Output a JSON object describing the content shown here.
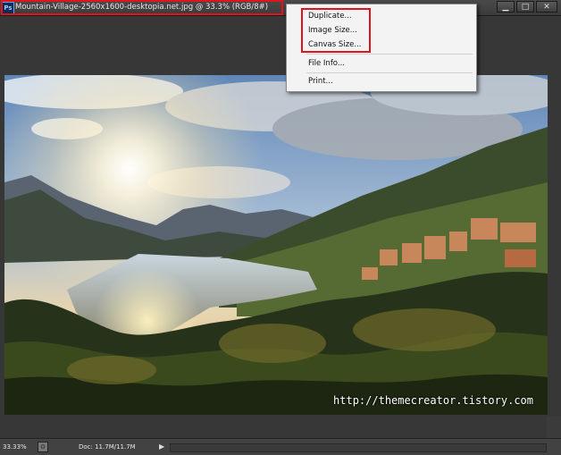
{
  "window": {
    "app_icon_text": "Ps",
    "doc_title": "Mountain-Village-2560x1600-desktopia.net.jpg @ 33.3% (RGB/8#)",
    "controls": {
      "minimize": "▁",
      "maximize": "□",
      "close": "✕"
    }
  },
  "context_menu": {
    "items": [
      "Duplicate...",
      "Image Size...",
      "Canvas Size...",
      "File Info...",
      "Print..."
    ]
  },
  "canvas": {
    "watermark": "http://themecreator.tistory.com"
  },
  "status": {
    "zoom": "33.33%",
    "doc_info": "Doc: 11.7M/11.7M",
    "arrow": "▶"
  },
  "colors": {
    "highlight": "#e0141b",
    "menu_bg": "#f3f3f3",
    "workspace": "#373737"
  }
}
